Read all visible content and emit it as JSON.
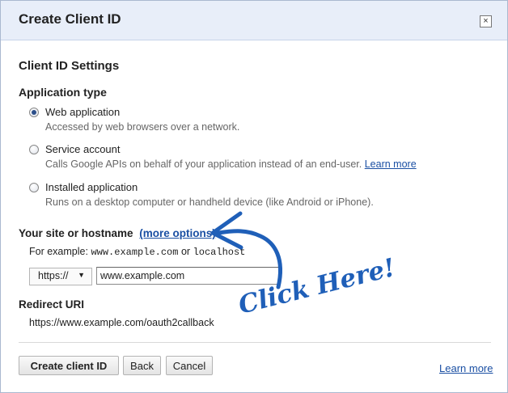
{
  "dialog": {
    "title": "Create Client ID",
    "close_glyph": "×"
  },
  "settings": {
    "heading": "Client ID Settings",
    "app_type_heading": "Application type",
    "options": [
      {
        "label": "Web application",
        "description": "Accessed by web browsers over a network.",
        "checked": true
      },
      {
        "label": "Service account",
        "description": "Calls Google APIs on behalf of your application instead of an end-user.",
        "link": "Learn more",
        "checked": false
      },
      {
        "label": "Installed application",
        "description": "Runs on a desktop computer or handheld device (like Android or iPhone).",
        "checked": false
      }
    ]
  },
  "host": {
    "heading": "Your site or hostname",
    "more_options": "(more options)",
    "example_prefix": "For example:",
    "example_1": "www.example.com",
    "example_or": "or",
    "example_2": "localhost",
    "protocol": "https://",
    "value": "www.example.com"
  },
  "redirect": {
    "heading": "Redirect URI",
    "value": "https://www.example.com/oauth2callback"
  },
  "buttons": {
    "create": "Create client ID",
    "back": "Back",
    "cancel": "Cancel"
  },
  "footer": {
    "learn_more": "Learn more"
  },
  "annotation": {
    "text": "Click Here!",
    "color": "#1f5fb8"
  }
}
